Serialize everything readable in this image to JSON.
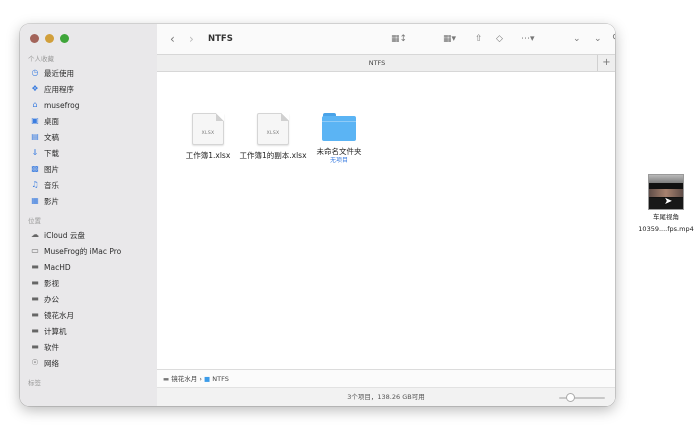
{
  "sidebar": {
    "favorites_title": "个人收藏",
    "favorites": [
      {
        "label": "最近使用",
        "icon": "clock-icon"
      },
      {
        "label": "应用程序",
        "icon": "applications-icon"
      },
      {
        "label": "musefrog",
        "icon": "home-icon"
      },
      {
        "label": "桌面",
        "icon": "desktop-icon"
      },
      {
        "label": "文稿",
        "icon": "document-icon"
      },
      {
        "label": "下载",
        "icon": "download-icon"
      },
      {
        "label": "图片",
        "icon": "pictures-icon"
      },
      {
        "label": "音乐",
        "icon": "music-icon"
      },
      {
        "label": "影片",
        "icon": "movies-icon"
      }
    ],
    "locations_title": "位置",
    "locations": [
      {
        "label": "iCloud 云盘",
        "icon": "cloud-icon"
      },
      {
        "label": "MuseFrog的 iMac Pro",
        "icon": "computer-icon"
      },
      {
        "label": "MacHD",
        "icon": "disk-icon"
      },
      {
        "label": "影视",
        "icon": "disk-icon"
      },
      {
        "label": "办公",
        "icon": "disk-icon"
      },
      {
        "label": "镜花水月",
        "icon": "disk-icon"
      },
      {
        "label": "计算机",
        "icon": "disk-icon"
      },
      {
        "label": "软件",
        "icon": "disk-icon"
      },
      {
        "label": "网络",
        "icon": "network-icon"
      }
    ],
    "tags_title": "标签"
  },
  "toolbar": {
    "title": "NTFS"
  },
  "tab": {
    "title": "NTFS"
  },
  "files": [
    {
      "name": "工作簿1.xlsx",
      "ext": "XLSX",
      "type": "xlsx"
    },
    {
      "name": "工作簿1的副本.xlsx",
      "ext": "XLSX",
      "type": "xlsx"
    },
    {
      "name": "未命名文件夹",
      "subtitle": "无项目",
      "type": "folder"
    }
  ],
  "pathbar": {
    "disk": "镜花水月",
    "sep": "›",
    "folder": "NTFS"
  },
  "status": {
    "text": "3个项目，138.26 GB可用",
    "zoom_level": 0.2
  },
  "desktop_file": {
    "line1": "车尾视角",
    "line2": "10359....fps.mp4"
  },
  "colors": {
    "accent": "#3b7de0",
    "folder": "#5bb4f4",
    "close": "#a3645a",
    "minimize": "#d19f3b",
    "zoom": "#3fa53a"
  }
}
